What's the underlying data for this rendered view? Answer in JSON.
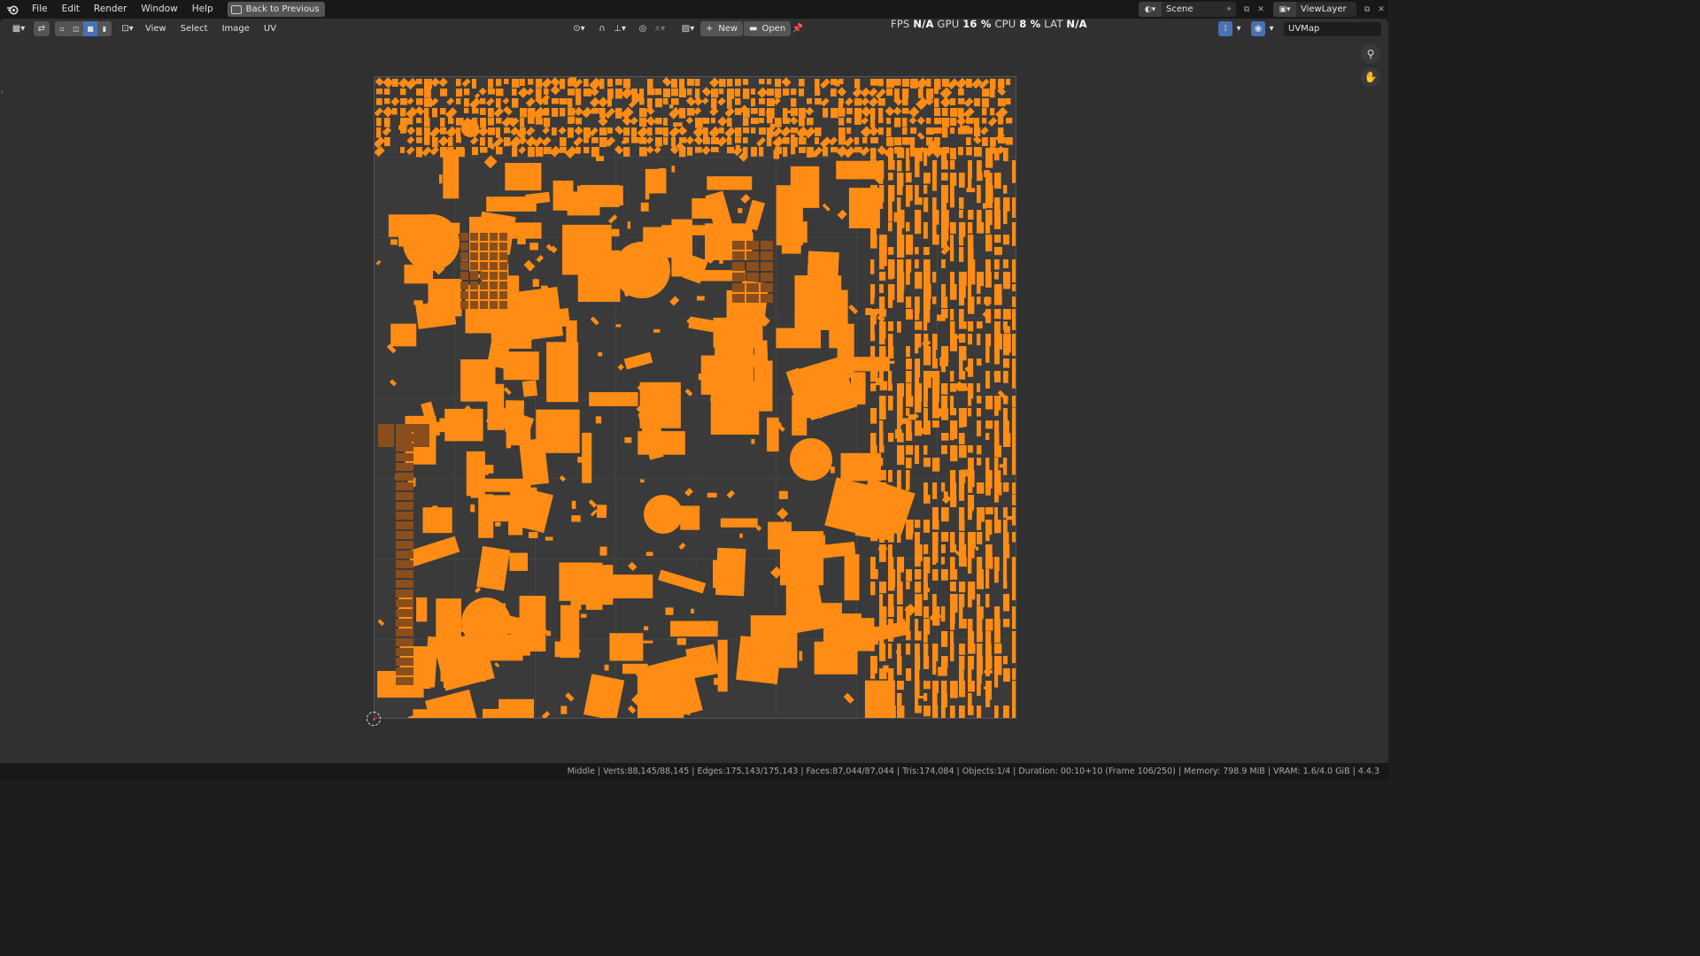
{
  "topbar": {
    "menus": [
      "File",
      "Edit",
      "Render",
      "Window",
      "Help"
    ],
    "back_label": "Back to Previous",
    "scene_name": "Scene",
    "viewlayer_name": "ViewLayer"
  },
  "header": {
    "menus": [
      "View",
      "Select",
      "Image",
      "UV"
    ],
    "new_label": "New",
    "open_label": "Open",
    "uvmap_name": "UVMap"
  },
  "stats": {
    "fps_label": "FPS",
    "fps_value": "N/A",
    "gpu_label": "GPU",
    "gpu_value": "16 %",
    "cpu_label": "CPU",
    "cpu_value": "8 %",
    "lat_label": "LAT",
    "lat_value": "N/A"
  },
  "statusbar": {
    "text": "Middle | Verts:88,145/88,145 | Edges:175,143/175,143 | Faces:87,044/87,044 | Tris:174,084 | Objects:1/4 | Duration: 00:10+10 (Frame 106/250) | Memory: 798.9 MiB | VRAM: 1.6/4.0 GiB | 4.4.3"
  },
  "colors": {
    "uv_island": "#ff8c14",
    "uv_island_dark": "#8a4e1c",
    "accent_blue": "#4772b3"
  },
  "icons": {
    "blender_logo": "blender-logo-icon",
    "zoom": "zoom-icon",
    "pan": "hand-pan-icon",
    "pin": "pin-icon"
  }
}
